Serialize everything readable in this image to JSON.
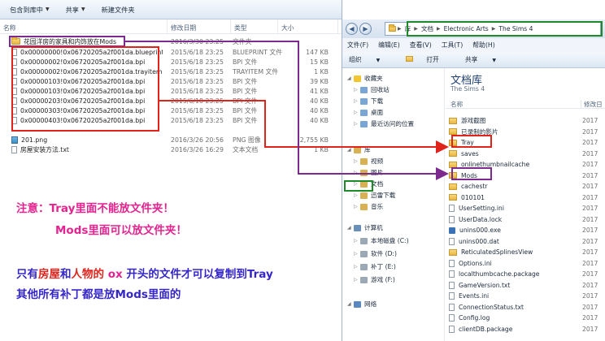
{
  "left_explorer": {
    "toolbar": [
      {
        "label": "包含到库中",
        "dropdown": true
      },
      {
        "label": "共享",
        "dropdown": true
      },
      {
        "label": "新建文件夹",
        "dropdown": false
      }
    ],
    "columns": {
      "name": "名称",
      "date": "修改日期",
      "type": "类型",
      "size": "大小"
    },
    "rows": [
      {
        "icon": "folder",
        "name": "花园洋房的家具和内饰放在Mods",
        "date": "2016/3/30 23:25",
        "type": "文件夹",
        "size": ""
      },
      {
        "icon": "file",
        "name": "0x00000000!0x06720205a2f001da.blueprint",
        "date": "2015/6/18 23:25",
        "type": "BLUEPRINT 文件",
        "size": "147 KB"
      },
      {
        "icon": "file",
        "name": "0x00000002!0x06720205a2f001da.bpi",
        "date": "2015/6/18 23:25",
        "type": "BPI 文件",
        "size": "15 KB"
      },
      {
        "icon": "file",
        "name": "0x00000002!0x06720205a2f001da.trayitem",
        "date": "2015/6/18 23:25",
        "type": "TRAYITEM 文件",
        "size": "1 KB"
      },
      {
        "icon": "file",
        "name": "0x00000103!0x06720205a2f001da.bpi",
        "date": "2015/6/18 23:25",
        "type": "BPI 文件",
        "size": "39 KB"
      },
      {
        "icon": "file",
        "name": "0x00000103!0x06720205a2f001da.bpi",
        "date": "2015/6/18 23:25",
        "type": "BPI 文件",
        "size": "41 KB"
      },
      {
        "icon": "file",
        "name": "0x00000203!0x06720205a2f001da.bpi",
        "date": "2015/6/18 23:25",
        "type": "BPI 文件",
        "size": "40 KB"
      },
      {
        "icon": "file",
        "name": "0x00000303!0x06720205a2f001da.bpi",
        "date": "2015/6/18 23:25",
        "type": "BPI 文件",
        "size": "40 KB"
      },
      {
        "icon": "file",
        "name": "0x00000403!0x06720205a2f001da.bpi",
        "date": "2015/6/18 23:25",
        "type": "BPI 文件",
        "size": "40 KB"
      },
      {
        "icon": "png",
        "name": "201.png",
        "date": "2016/3/26 20:56",
        "type": "PNG 图像",
        "size": "2,755 KB"
      },
      {
        "icon": "file",
        "name": "房屋安装方法.txt",
        "date": "2016/3/26 16:29",
        "type": "文本文档",
        "size": "1 KB"
      }
    ]
  },
  "notes": {
    "line1": "注意：Tray里面不能放文件夹！",
    "line2": "Mods里面可以放文件夹！",
    "line3_a": "只有",
    "line3_b": "房屋",
    "line3_c": "和",
    "line3_d": "人物的",
    "line3_e": " ox ",
    "line3_f": "开头的文件才可以复制到Tray",
    "line4": "其他所有补丁都是放Mods里面的"
  },
  "right_explorer": {
    "breadcrumb": [
      "库",
      "文档",
      "Electronic Arts",
      "The Sims 4"
    ],
    "menu": [
      "文件(F)",
      "编辑(E)",
      "查看(V)",
      "工具(T)",
      "帮助(H)"
    ],
    "commands": [
      {
        "label": "组织",
        "dropdown": true
      },
      {
        "label": "打开",
        "dropdown": false
      },
      {
        "label": "共享",
        "dropdown": true
      }
    ],
    "nav": [
      {
        "label": "收藏夹",
        "icon": "star",
        "level": 0
      },
      {
        "label": "回收站",
        "icon": "blue",
        "level": 1
      },
      {
        "label": "下载",
        "icon": "blue",
        "level": 1
      },
      {
        "label": "桌面",
        "icon": "blue",
        "level": 1
      },
      {
        "label": "最近访问的位置",
        "icon": "blue",
        "level": 1
      },
      {
        "label": "库",
        "icon": "lib",
        "level": 0
      },
      {
        "label": "视频",
        "icon": "lib",
        "level": 1
      },
      {
        "label": "图片",
        "icon": "lib",
        "level": 1
      },
      {
        "label": "文档",
        "icon": "lib",
        "level": 1
      },
      {
        "label": "迅雷下载",
        "icon": "lib",
        "level": 1
      },
      {
        "label": "音乐",
        "icon": "lib",
        "level": 1
      },
      {
        "label": "计算机",
        "icon": "pc",
        "level": 0
      },
      {
        "label": "本地磁盘 (C:)",
        "icon": "drive",
        "level": 1
      },
      {
        "label": "软件 (D:)",
        "icon": "drive",
        "level": 1
      },
      {
        "label": "补丁 (E:)",
        "icon": "drive",
        "level": 1
      },
      {
        "label": "游戏 (F:)",
        "icon": "drive",
        "level": 1
      },
      {
        "label": "网络",
        "icon": "net",
        "level": 0
      }
    ],
    "library_title": "文档库",
    "library_subtitle": "The Sims 4",
    "columns": {
      "name": "名称",
      "date": "修改日"
    },
    "rows": [
      {
        "icon": "folder",
        "name": "游戏截图",
        "date": "2017"
      },
      {
        "icon": "folder",
        "name": "已录制的影片",
        "date": "2017"
      },
      {
        "icon": "folder",
        "name": "Tray",
        "date": "2017"
      },
      {
        "icon": "folder",
        "name": "saves",
        "date": "2017"
      },
      {
        "icon": "folder",
        "name": "onlinethumbnailcache",
        "date": "2017"
      },
      {
        "icon": "folder",
        "name": "Mods",
        "date": "2017"
      },
      {
        "icon": "folder",
        "name": "cachestr",
        "date": "2017"
      },
      {
        "icon": "folder",
        "name": "010101",
        "date": "2017"
      },
      {
        "icon": "file",
        "name": "UserSetting.ini",
        "date": "2017"
      },
      {
        "icon": "file",
        "name": "UserData.lock",
        "date": "2017"
      },
      {
        "icon": "app",
        "name": "unins000.exe",
        "date": "2017"
      },
      {
        "icon": "file",
        "name": "unins000.dat",
        "date": "2017"
      },
      {
        "icon": "folder",
        "name": "ReticulatedSplinesView",
        "date": "2017"
      },
      {
        "icon": "file",
        "name": "Options.ini",
        "date": "2017"
      },
      {
        "icon": "file",
        "name": "localthumbcache.package",
        "date": "2017"
      },
      {
        "icon": "file",
        "name": "GameVersion.txt",
        "date": "2017"
      },
      {
        "icon": "file",
        "name": "Events.ini",
        "date": "2017"
      },
      {
        "icon": "file",
        "name": "ConnectionStatus.txt",
        "date": "2017"
      },
      {
        "icon": "file",
        "name": "Config.log",
        "date": "2017"
      },
      {
        "icon": "file",
        "name": "clientDB.package",
        "date": "2017"
      }
    ]
  },
  "colors": {
    "red": "#e0231b",
    "purple": "#7d2a8e",
    "green": "#1e8a2a",
    "pink": "#e3238f",
    "blue": "#3426c9"
  }
}
